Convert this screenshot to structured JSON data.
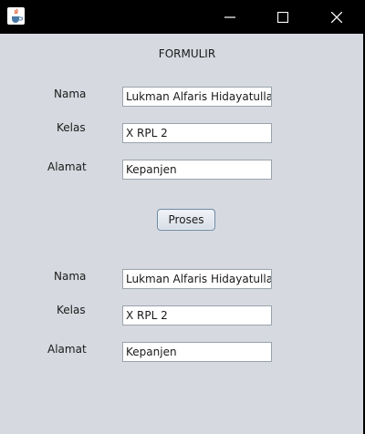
{
  "window": {
    "icon": "java-cup-icon",
    "controls": [
      "minimize-icon",
      "maximize-icon",
      "close-icon"
    ]
  },
  "form": {
    "heading": "FORMULIR",
    "input": {
      "nama_label": "Nama",
      "nama_value": "Lukman Alfaris Hidayatullah",
      "kelas_label": "Kelas",
      "kelas_value": "X RPL 2",
      "alamat_label": "Alamat",
      "alamat_value": "Kepanjen"
    },
    "submit_label": "Proses",
    "output": {
      "nama_label": "Nama",
      "nama_value": "Lukman Alfaris Hidayatullah",
      "kelas_label": "Kelas",
      "kelas_value": "X RPL 2",
      "alamat_label": "Alamat",
      "alamat_value": "Kepanjen"
    }
  }
}
